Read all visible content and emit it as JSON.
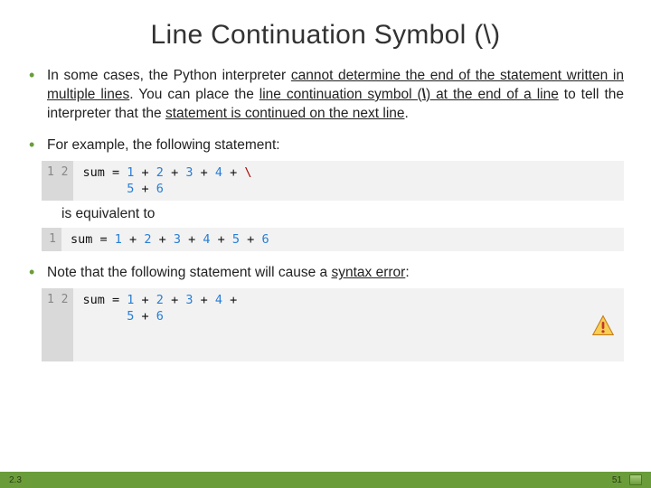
{
  "title": "Line Continuation Symbol (\\)",
  "bullets": {
    "b1": {
      "t1": "In some cases, the Python interpreter ",
      "u1": "cannot determine the end of the statement written in multiple lines",
      "t2": ". You can place the ",
      "u2": "line continuation symbol (",
      "bold": "\\",
      "u3": ") at the end of a line",
      "t3": " to tell the interpreter that the ",
      "u4": "statement is continued on the next line",
      "t4": "."
    },
    "b2": "For example, the following statement:",
    "equiv": "is equivalent to",
    "b3": {
      "t1": "Note that the following statement will cause a ",
      "u1": "syntax error",
      "t2": ":"
    }
  },
  "code": {
    "block1": {
      "gutter": "1\n2",
      "line1": {
        "pre": "sum = ",
        "n1": "1",
        "op1": " + ",
        "n2": "2",
        "op2": " + ",
        "n3": "3",
        "op3": " + ",
        "n4": "4",
        "op4": " + ",
        "bs": "\\"
      },
      "line2": {
        "pad": "      ",
        "n1": "5",
        "op1": " + ",
        "n2": "6"
      }
    },
    "block2": {
      "gutter": "1",
      "line1": {
        "pre": "sum = ",
        "n1": "1",
        "op1": " + ",
        "n2": "2",
        "op2": " + ",
        "n3": "3",
        "op3": " + ",
        "n4": "4",
        "op4": " + ",
        "n5": "5",
        "op5": " + ",
        "n6": "6"
      }
    },
    "block3": {
      "gutter": "1\n2",
      "line1": {
        "pre": "sum = ",
        "n1": "1",
        "op1": " + ",
        "n2": "2",
        "op2": " + ",
        "n3": "3",
        "op3": " + ",
        "n4": "4",
        "op4": " +"
      },
      "line2": {
        "pad": "      ",
        "n1": "5",
        "op1": " + ",
        "n2": "6"
      }
    }
  },
  "footer": {
    "version": "2.3",
    "page": "51"
  }
}
